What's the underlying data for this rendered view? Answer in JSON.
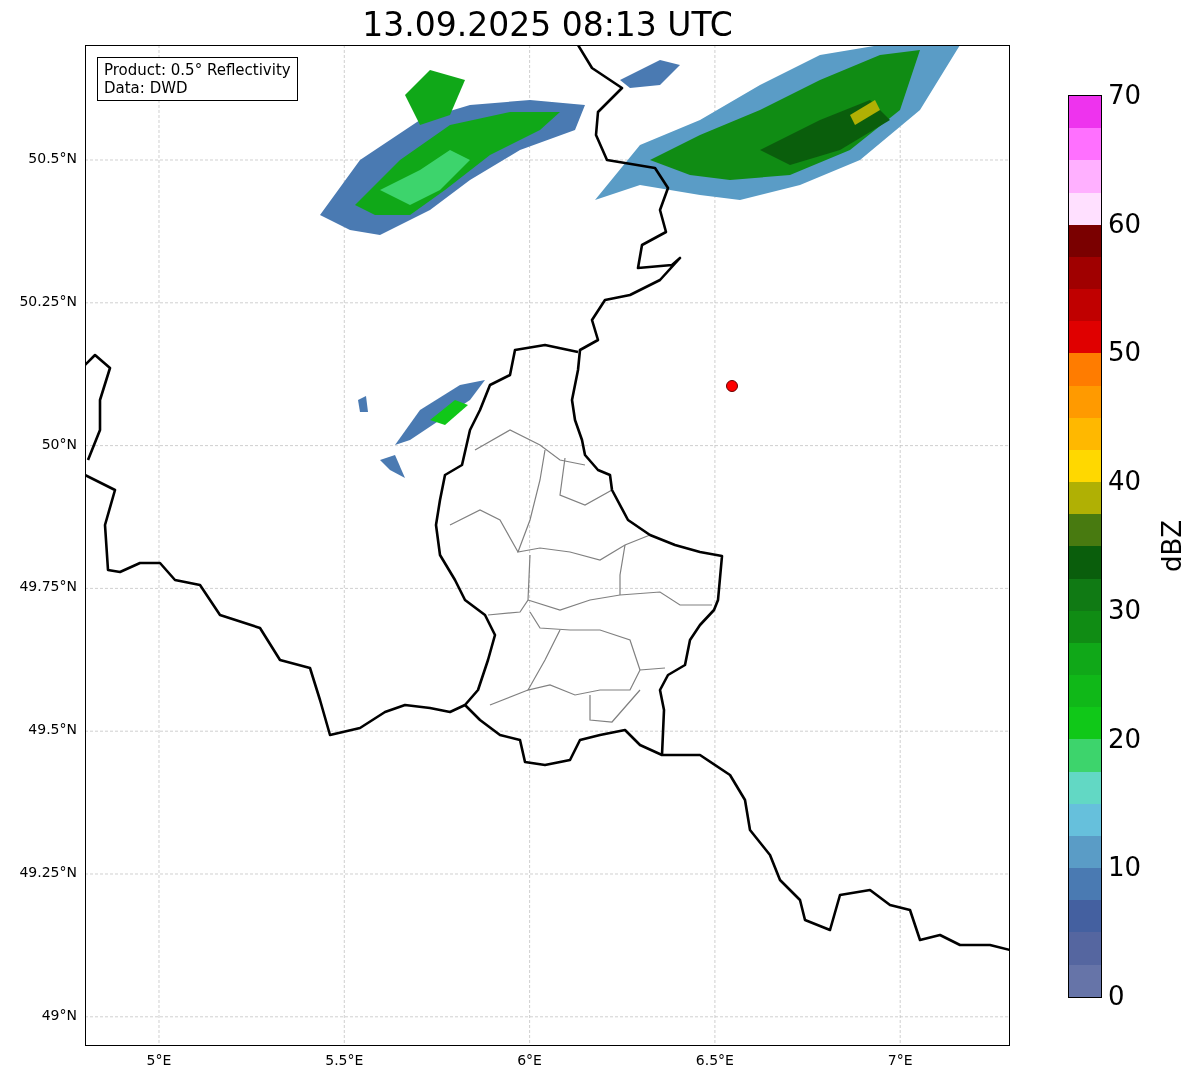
{
  "title": "13.09.2025 08:13 UTC",
  "info_box": [
    "Product: 0.5° Reflectivity",
    "Data: DWD"
  ],
  "map": {
    "y_ticks": [
      "50.5°N",
      "50.25°N",
      "50°N",
      "49.75°N",
      "49.5°N",
      "49.25°N",
      "49°N"
    ],
    "x_ticks": [
      "5°E",
      "5.5°E",
      "6°E",
      "6.5°E",
      "7°E"
    ]
  },
  "colorbar": {
    "label": "dBZ",
    "ticks": [
      "70",
      "60",
      "50",
      "40",
      "30",
      "20",
      "10",
      "0"
    ],
    "bins": [
      {
        "color": "#6674a8"
      },
      {
        "color": "#5566a0"
      },
      {
        "color": "#4460a0"
      },
      {
        "color": "#4a7ab2"
      },
      {
        "color": "#5a9cc6"
      },
      {
        "color": "#66c0dc"
      },
      {
        "color": "#62d8c4"
      },
      {
        "color": "#3dd46c"
      },
      {
        "color": "#10c818"
      },
      {
        "color": "#10b818"
      },
      {
        "color": "#10a818"
      },
      {
        "color": "#108c14"
      },
      {
        "color": "#107a14"
      },
      {
        "color": "#0a5e0c"
      },
      {
        "color": "#487a10"
      },
      {
        "color": "#b0b004"
      },
      {
        "color": "#ffd800"
      },
      {
        "color": "#ffb800"
      },
      {
        "color": "#ff9a00"
      },
      {
        "color": "#ff7c00"
      },
      {
        "color": "#e00000"
      },
      {
        "color": "#c00000"
      },
      {
        "color": "#a00000"
      },
      {
        "color": "#7a0000"
      },
      {
        "color": "#ffe0ff"
      },
      {
        "color": "#ffb0ff"
      },
      {
        "color": "#ff70ff"
      },
      {
        "color": "#ee33ee"
      }
    ]
  }
}
